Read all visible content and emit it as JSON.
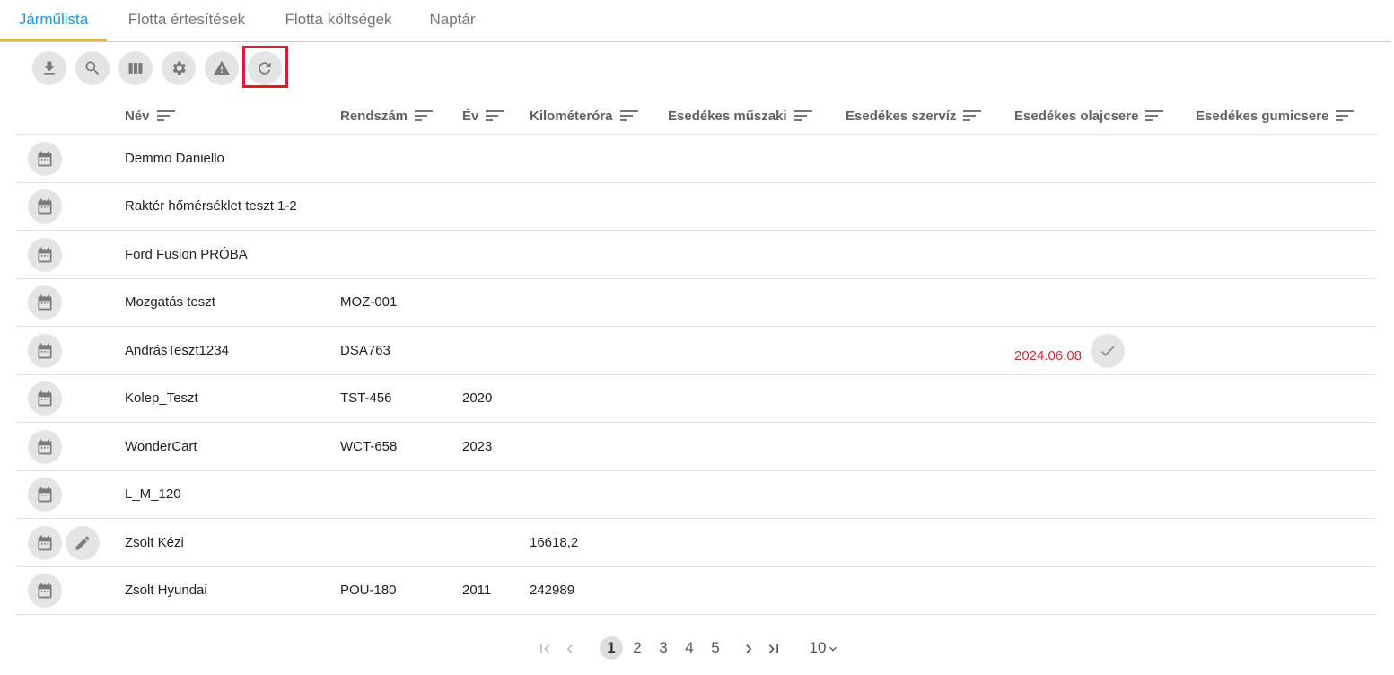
{
  "tabs": [
    {
      "label": "Járműlista",
      "active": true
    },
    {
      "label": "Flotta értesítések",
      "active": false
    },
    {
      "label": "Flotta költségek",
      "active": false
    },
    {
      "label": "Naptár",
      "active": false
    }
  ],
  "toolbar": {
    "buttons": [
      "download-icon",
      "search-icon",
      "columns-icon",
      "gear-icon",
      "warning-icon",
      "refresh-icon"
    ]
  },
  "table": {
    "columns": [
      "Név",
      "Rendszám",
      "Év",
      "Kilométeróra",
      "Esedékes műszaki",
      "Esedékes szervíz",
      "Esedékes olajcsere",
      "Esedékes gumicsere"
    ],
    "rows": [
      {
        "name": "Demmo Daniello",
        "plate": "",
        "year": "",
        "km": "",
        "oil": ""
      },
      {
        "name": "Raktér hőmérséklet teszt 1-2",
        "plate": "",
        "year": "",
        "km": "",
        "oil": ""
      },
      {
        "name": "Ford Fusion PRÓBA",
        "plate": "",
        "year": "",
        "km": "",
        "oil": ""
      },
      {
        "name": "Mozgatás teszt",
        "plate": "MOZ-001",
        "year": "",
        "km": "",
        "oil": ""
      },
      {
        "name": "AndrásTeszt1234",
        "plate": "DSA763",
        "year": "",
        "km": "",
        "oil": "2024.06.08"
      },
      {
        "name": "Kolep_Teszt",
        "plate": "TST-456",
        "year": "2020",
        "km": "",
        "oil": ""
      },
      {
        "name": "WonderCart",
        "plate": "WCT-658",
        "year": "2023",
        "km": "",
        "oil": ""
      },
      {
        "name": "L_M_120",
        "plate": "",
        "year": "",
        "km": "",
        "oil": ""
      },
      {
        "name": "Zsolt Kézi",
        "plate": "",
        "year": "",
        "km": "16618,2",
        "oil": ""
      },
      {
        "name": "Zsolt Hyundai",
        "plate": "POU-180",
        "year": "2011",
        "km": "242989",
        "oil": ""
      }
    ]
  },
  "pagination": {
    "pages": [
      "1",
      "2",
      "3",
      "4",
      "5"
    ],
    "current": "1",
    "page_size": "10"
  },
  "colors": {
    "accent": "#2196d3",
    "tab_underline": "#f2b51e",
    "highlight": "#e21b2a",
    "due_date": "#c62f3e"
  }
}
